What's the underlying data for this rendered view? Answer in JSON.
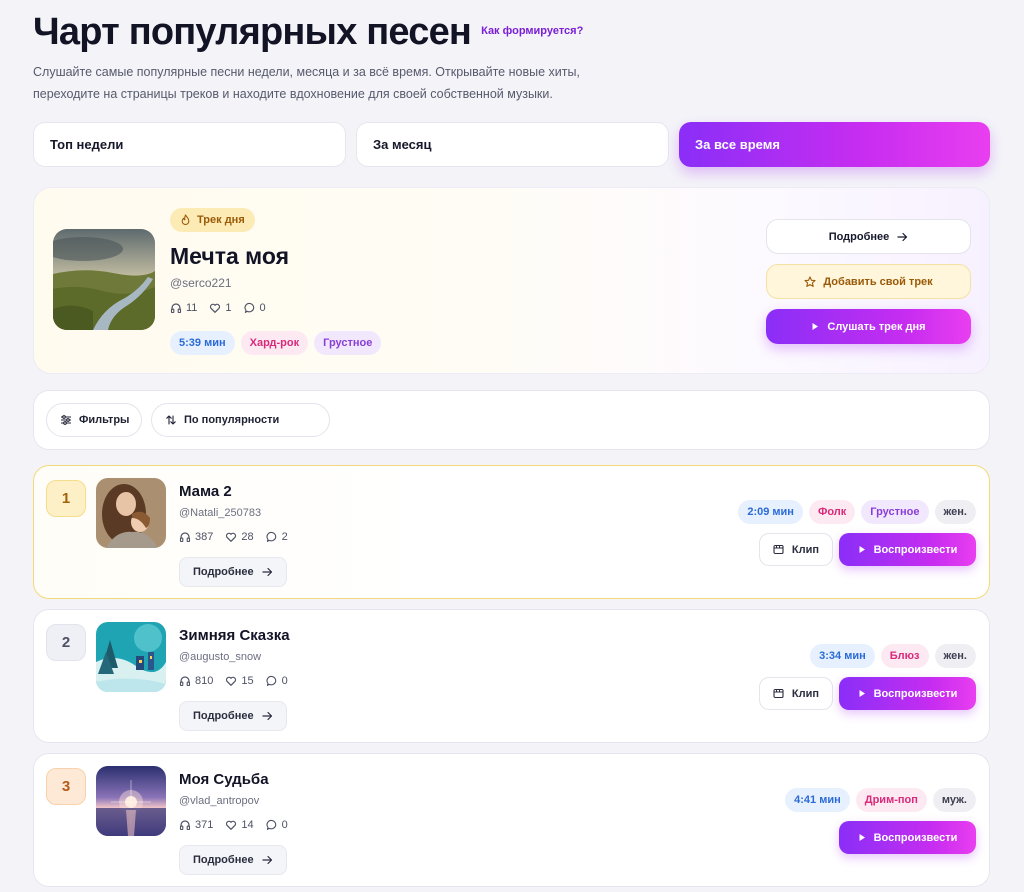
{
  "header": {
    "title": "Чарт популярных песен",
    "how_link": "Как формируется?",
    "subtitle_line1": "Слушайте самые популярные песни недели, месяца и за всё время. Открывайте новые хиты,",
    "subtitle_line2": "переходите на страницы треков и находите вдохновение для своей собственной музыки."
  },
  "tabs": [
    {
      "label": "Топ недели",
      "active": false
    },
    {
      "label": "За месяц",
      "active": false
    },
    {
      "label": "За все время",
      "active": true
    }
  ],
  "track_of_day": {
    "badge": "Трек дня",
    "title": "Мечта моя",
    "author": "@serco221",
    "listens": "11",
    "likes": "1",
    "comments": "0",
    "duration": "5:39 мин",
    "genre": "Хард-рок",
    "mood": "Грустное",
    "more_label": "Подробнее",
    "add_label": "Добавить свой трек",
    "listen_label": "Слушать трек дня"
  },
  "filters": {
    "filters_label": "Фильтры",
    "sort_label": "По популярности"
  },
  "tracks": [
    {
      "rank": "1",
      "title": "Мама 2",
      "author": "@Natali_250783",
      "listens": "387",
      "likes": "28",
      "comments": "2",
      "duration": "2:09 мин",
      "genre": "Фолк",
      "mood": "Грустное",
      "voice": "жен.",
      "more_label": "Подробнее",
      "clip_label": "Клип",
      "play_label": "Воспроизвести"
    },
    {
      "rank": "2",
      "title": "Зимняя Сказка",
      "author": "@augusto_snow",
      "listens": "810",
      "likes": "15",
      "comments": "0",
      "duration": "3:34 мин",
      "genre": "Блюз",
      "voice": "жен.",
      "more_label": "Подробнее",
      "clip_label": "Клип",
      "play_label": "Воспроизвести"
    },
    {
      "rank": "3",
      "title": "Моя Судьба",
      "author": "@vlad_antropov",
      "listens": "371",
      "likes": "14",
      "comments": "0",
      "duration": "4:41 мин",
      "genre": "Дрим-поп",
      "voice": "муж.",
      "more_label": "Подробнее",
      "play_label": "Воспроизвести"
    }
  ],
  "colors": {
    "accent_gradient_start": "#8a2ef7",
    "accent_gradient_end": "#e93ef0",
    "link": "#7b1fd6",
    "gold": "#fdf0c7"
  }
}
